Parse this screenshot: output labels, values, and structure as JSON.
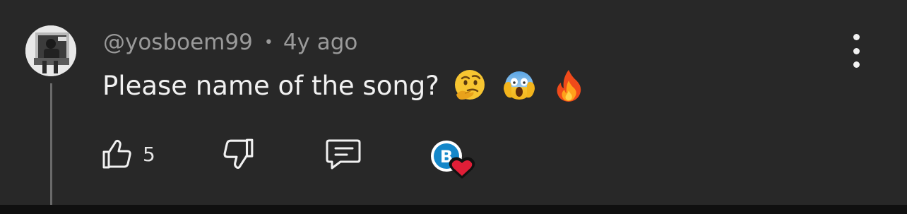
{
  "comment": {
    "author": "@yosboem99",
    "separator": "•",
    "time_ago": "4y ago",
    "text": "Please name of the song?",
    "emojis": [
      "thinking-face-emoji",
      "screaming-in-fear-emoji",
      "fire-emoji"
    ]
  },
  "actions": {
    "like_count": "5",
    "like_icon": "thumbs-up-icon",
    "dislike_icon": "thumbs-down-icon",
    "reply_icon": "reply-comment-icon",
    "creator_heart": {
      "badge_letter": "B",
      "icon": "creator-heart-icon"
    }
  },
  "menu": {
    "icon": "more-vertical-icon"
  },
  "colors": {
    "background": "#282828",
    "text_primary": "#f1f1f1",
    "text_secondary": "#9a9a9a",
    "heart": "#e01e37",
    "badge_blue": "#1487c9"
  }
}
